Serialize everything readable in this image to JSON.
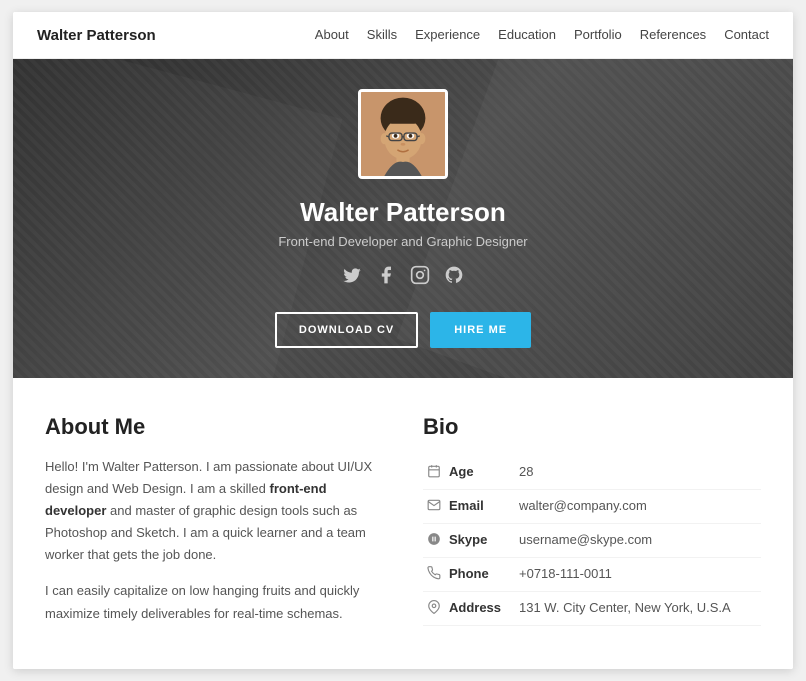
{
  "nav": {
    "brand": "Walter Patterson",
    "links": [
      "About",
      "Skills",
      "Experience",
      "Education",
      "Portfolio",
      "References",
      "Contact"
    ]
  },
  "hero": {
    "name": "Walter Patterson",
    "title": "Front-end Developer and Graphic Designer",
    "socials": [
      {
        "name": "twitter",
        "icon": "𝕏"
      },
      {
        "name": "facebook",
        "icon": "f"
      },
      {
        "name": "instagram",
        "icon": "◎"
      },
      {
        "name": "github",
        "icon": "⊙"
      }
    ],
    "btn_download": "DOWNLOAD CV",
    "btn_hire": "HIRE ME"
  },
  "about": {
    "heading": "About Me",
    "para1_plain1": "Hello! I'm Walter Patterson. I am passionate about UI/UX design and Web Design. I am a skilled ",
    "para1_bold": "front-end developer",
    "para1_plain2": " and master of graphic design tools such as Photoshop and Sketch. I am a quick learner and a team worker that gets the job done.",
    "para2": "I can easily capitalize on low hanging fruits and quickly maximize timely deliverables for real-time schemas.",
    "bio_heading": "Bio",
    "bio": {
      "age_label": "Age",
      "age_value": "28",
      "email_label": "Email",
      "email_value": "walter@company.com",
      "skype_label": "Skype",
      "skype_value": "username@skype.com",
      "phone_label": "Phone",
      "phone_value": "+0718-111-0011",
      "address_label": "Address",
      "address_value": "131 W. City Center, New York, U.S.A"
    }
  }
}
